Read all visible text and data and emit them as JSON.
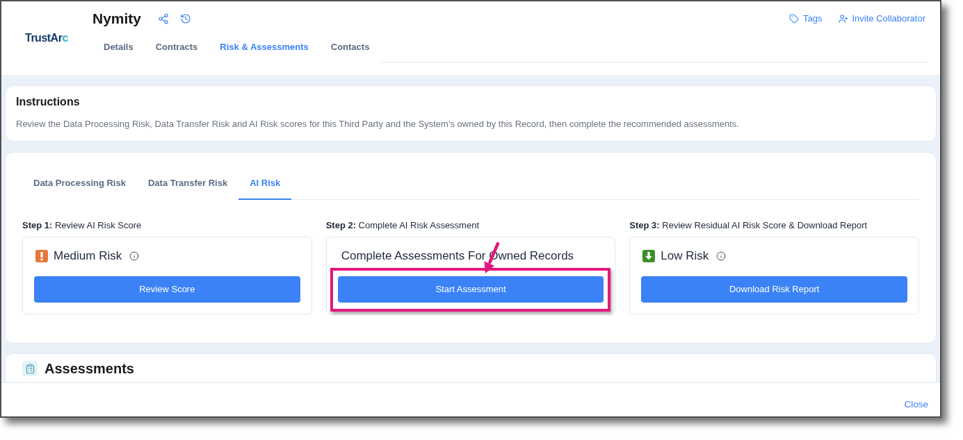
{
  "header": {
    "logo": "TrustArc",
    "title": "Nymity",
    "actions": [
      {
        "kind": "tags",
        "label": "Tags"
      },
      {
        "kind": "invite",
        "label": "Invite Collaborator"
      }
    ],
    "tabs": [
      {
        "label": "Details",
        "selected": false
      },
      {
        "label": "Contracts",
        "selected": false
      },
      {
        "label": "Risk & Assessments",
        "selected": true
      },
      {
        "label": "Contacts",
        "selected": false
      }
    ]
  },
  "instructions": {
    "title": "Instructions",
    "text": "Review the Data Processing Risk, Data Transfer Risk and AI Risk scores for this Third Party and the System’s owned by this Record, then complete the recommended assessments."
  },
  "risk_panel": {
    "tabs": [
      {
        "label": "Data Processing Risk",
        "selected": false
      },
      {
        "label": "Data Transfer Risk",
        "selected": false
      },
      {
        "label": "AI Risk",
        "selected": true
      }
    ],
    "steps": [
      {
        "kind": "medium",
        "label": "**Step 1:** Review AI Risk Score",
        "heading": "Medium Risk",
        "info": true,
        "button": "Review Score",
        "highlighted": false
      },
      {
        "kind": "plain",
        "label": "**Step 2:** Complete AI Risk Assessment",
        "heading": "Complete Assessments For Owned Records",
        "info": false,
        "button": "Start Assessment",
        "highlighted": true
      },
      {
        "kind": "low",
        "label": "**Step 3:** Review Residual AI Risk Score & Download Report",
        "heading": "Low Risk",
        "info": true,
        "button": "Download Risk Report",
        "highlighted": false
      }
    ]
  },
  "assessments": {
    "title": "Assessments"
  },
  "footer": {
    "close": "Close"
  }
}
